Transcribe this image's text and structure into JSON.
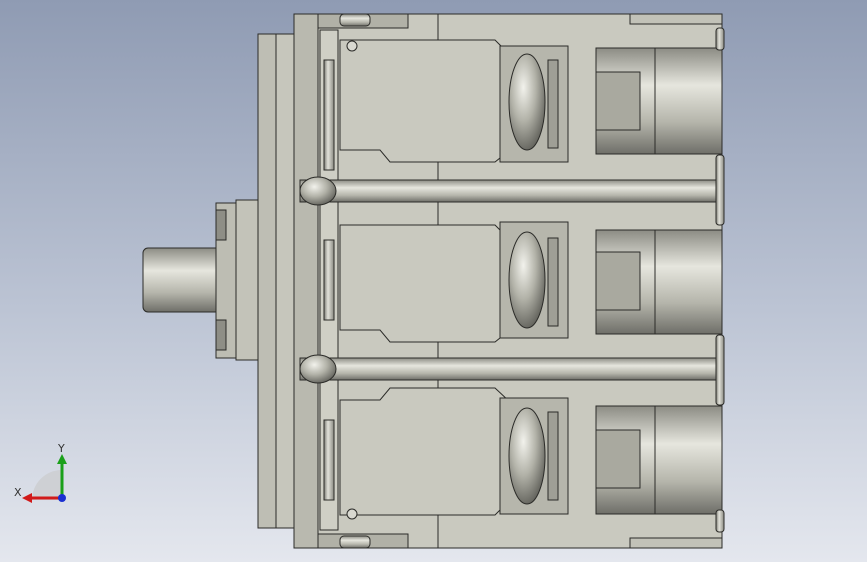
{
  "viewport": {
    "background_top": "#8f9bb3",
    "background_bottom": "#e4e7ee"
  },
  "model": {
    "body_color": "#c9c9bf",
    "shade_color": "#a8a89c",
    "line_color": "#2b2b28"
  },
  "triad": {
    "x_label": "X",
    "y_label": "Y",
    "x_color": "#d11a1a",
    "y_color": "#1aa01a",
    "z_color": "#1a2fd1"
  }
}
